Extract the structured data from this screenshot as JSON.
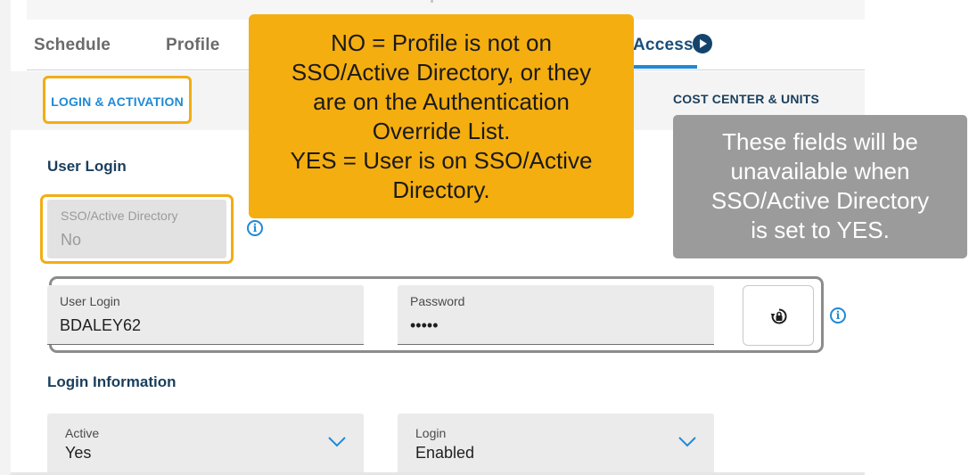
{
  "tabs": {
    "schedule": "Schedule",
    "profile": "Profile",
    "access": "Access"
  },
  "subnav": {
    "login_activation": "LOGIN & ACTIVATION",
    "cost_center": "COST CENTER & UNITS"
  },
  "user_login_section": {
    "title": "User Login",
    "sso": {
      "label": "SSO/Active Directory",
      "value": "No"
    },
    "user_login": {
      "label": "User Login",
      "value": "BDALEY62"
    },
    "password": {
      "label": "Password",
      "value": "•••••"
    }
  },
  "login_information_section": {
    "title": "Login Information",
    "active": {
      "label": "Active",
      "value": "Yes"
    },
    "login": {
      "label": "Login",
      "value": "Enabled"
    }
  },
  "callouts": {
    "yellow": [
      "NO = Profile is not on",
      "SSO/Active Directory, or they",
      "are on the Authentication",
      "Override List.",
      "YES = User is on SSO/Active",
      "Directory."
    ],
    "gray": [
      "These fields will be",
      "unavailable when",
      "SSO/Active Directory",
      "is set to YES."
    ]
  },
  "colors": {
    "accent_blue": "#1e8ad6",
    "navy": "#1a3e5c",
    "highlight_orange": "#f2ad14",
    "callout_yellow": "#f5ae10",
    "callout_gray": "#9b9b9b"
  },
  "icons": {
    "info": "info-icon",
    "next_tab": "chevron-right-circle-icon",
    "reset_password": "lock-reset-icon",
    "dropdown": "chevron-down-icon"
  }
}
